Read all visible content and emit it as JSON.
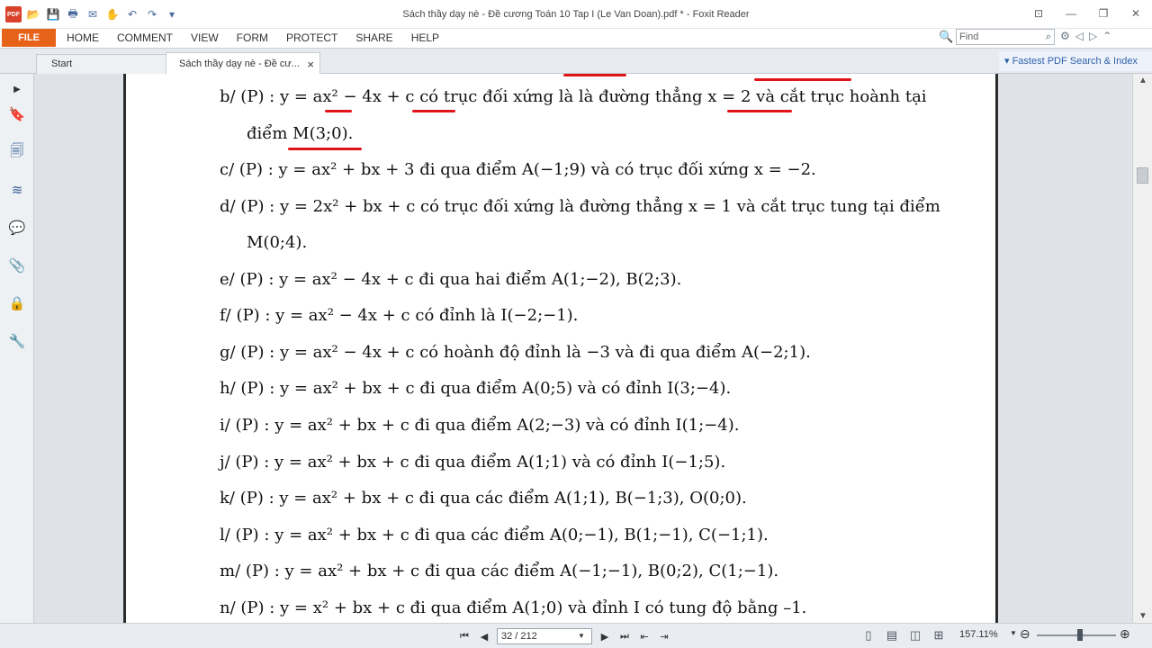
{
  "app": {
    "title": "Sách thầy dạy nè - Đề cương Toán 10 Tap I (Le Van Doan).pdf * - Foxit Reader"
  },
  "quick_access": [
    "pdf-logo-icon",
    "open-icon",
    "save-icon",
    "print-icon",
    "email-icon",
    "hand-icon",
    "undo-icon",
    "redo-icon",
    "customize-icon"
  ],
  "ribbon": {
    "file_label": "FILE",
    "tabs": [
      "HOME",
      "COMMENT",
      "VIEW",
      "FORM",
      "PROTECT",
      "SHARE",
      "HELP"
    ],
    "find_placeholder": "Find"
  },
  "doc_tabs": {
    "start_label": "Start",
    "doc_label": "Sách thầy dạy nè - Đề cư...",
    "close": "×"
  },
  "fastest_search": "Fastest PDF Search & Index",
  "pdf_lines": [
    {
      "id": "b",
      "text": "b/  (P) : y = ax² − 4x + c  có trục đối xứng là là đường thẳng  x = 2  và cắt trục hoành tại"
    },
    {
      "id": "b2",
      "text": "điểm  M(3;0)."
    },
    {
      "id": "c",
      "text": "c/  (P) : y = ax² + bx + 3  đi qua điểm  A(−1;9)  và có trục đối xứng  x = −2."
    },
    {
      "id": "d",
      "text": "d/  (P) : y = 2x² + bx + c  có trục đối xứng là đường thẳng  x = 1  và cắt trục tung tại điểm"
    },
    {
      "id": "d2",
      "text": "M(0;4)."
    },
    {
      "id": "e",
      "text": "e/  (P) : y = ax² − 4x + c  đi qua hai điểm  A(1;−2),  B(2;3)."
    },
    {
      "id": "f",
      "text": "f/  (P) : y = ax² − 4x + c  có đỉnh là  I(−2;−1)."
    },
    {
      "id": "g",
      "text": "g/  (P) : y = ax² − 4x + c  có hoành độ đỉnh là  −3  và đi qua điểm  A(−2;1)."
    },
    {
      "id": "h",
      "text": "h/  (P) : y = ax² + bx + c  đi qua điểm  A(0;5)  và có đỉnh  I(3;−4)."
    },
    {
      "id": "i",
      "text": "i/  (P) : y = ax² + bx + c  đi qua điểm  A(2;−3)  và có đỉnh  I(1;−4)."
    },
    {
      "id": "j",
      "text": "j/  (P) : y = ax² + bx + c  đi qua điểm  A(1;1)  và có đỉnh  I(−1;5)."
    },
    {
      "id": "k",
      "text": "k/  (P) : y = ax² + bx + c  đi qua các điểm  A(1;1),  B(−1;3),  O(0;0)."
    },
    {
      "id": "l",
      "text": "l/  (P) : y = ax² + bx + c  đi qua các điểm  A(0;−1),  B(1;−1),  C(−1;1)."
    },
    {
      "id": "m",
      "text": "m/  (P) : y = ax² + bx + c  đi qua các điểm  A(−1;−1),  B(0;2),  C(1;−1)."
    },
    {
      "id": "n",
      "text": "n/  (P) : y = x² + bx + c  đi qua điểm  A(1;0)  và đỉnh I có tung độ bằng –1."
    }
  ],
  "status": {
    "page_value": "32 / 212",
    "zoom": "157.11%"
  }
}
